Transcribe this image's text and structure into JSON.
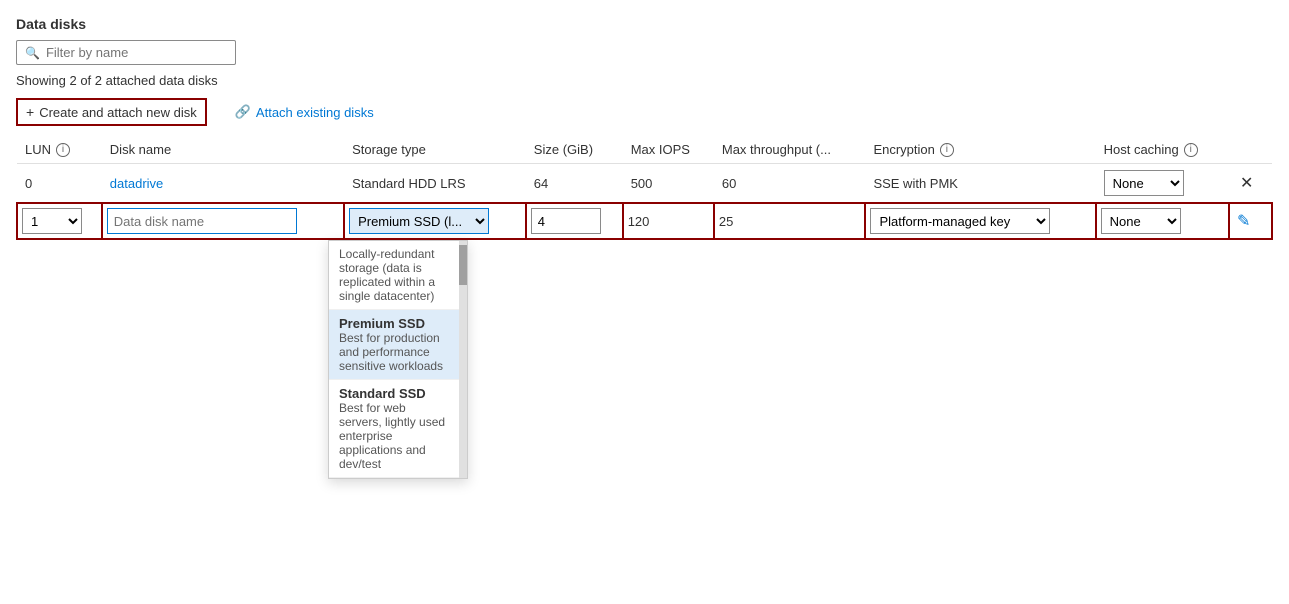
{
  "page": {
    "section_title": "Data disks",
    "filter_placeholder": "Filter by name",
    "showing_text": "Showing 2 of 2 attached data disks"
  },
  "actions": {
    "create_label": "Create and attach new disk",
    "attach_label": "Attach existing disks"
  },
  "table": {
    "columns": [
      {
        "id": "lun",
        "label": "LUN",
        "has_info": true
      },
      {
        "id": "disk_name",
        "label": "Disk name"
      },
      {
        "id": "storage_type",
        "label": "Storage type"
      },
      {
        "id": "size",
        "label": "Size (GiB)"
      },
      {
        "id": "max_iops",
        "label": "Max IOPS"
      },
      {
        "id": "max_throughput",
        "label": "Max throughput (..."
      },
      {
        "id": "encryption",
        "label": "Encryption",
        "has_info": true
      },
      {
        "id": "host_caching",
        "label": "Host caching",
        "has_info": true
      }
    ],
    "rows": [
      {
        "lun": "0",
        "disk_name": "datadrive",
        "storage_type": "Standard HDD LRS",
        "size": "64",
        "max_iops": "500",
        "max_throughput": "60",
        "encryption": "SSE with PMK",
        "host_caching": "None",
        "is_link": true
      }
    ],
    "edit_row": {
      "lun_value": "1",
      "name_placeholder": "Data disk name",
      "storage_type_value": "Premium SSD (l...",
      "size_value": "4",
      "max_iops": "120",
      "max_throughput": "25",
      "encryption_value": "Platform-managed key",
      "host_caching_value": "None"
    }
  },
  "storage_dropdown": {
    "items": [
      {
        "title": "Locally-redundant storage",
        "desc": "(data is replicated within a single datacenter)"
      },
      {
        "title": "Premium SSD",
        "desc": "Best for production and performance sensitive workloads",
        "selected": true
      },
      {
        "title": "Standard SSD",
        "desc": "Best for web servers, lightly used enterprise applications and dev/test"
      }
    ]
  }
}
